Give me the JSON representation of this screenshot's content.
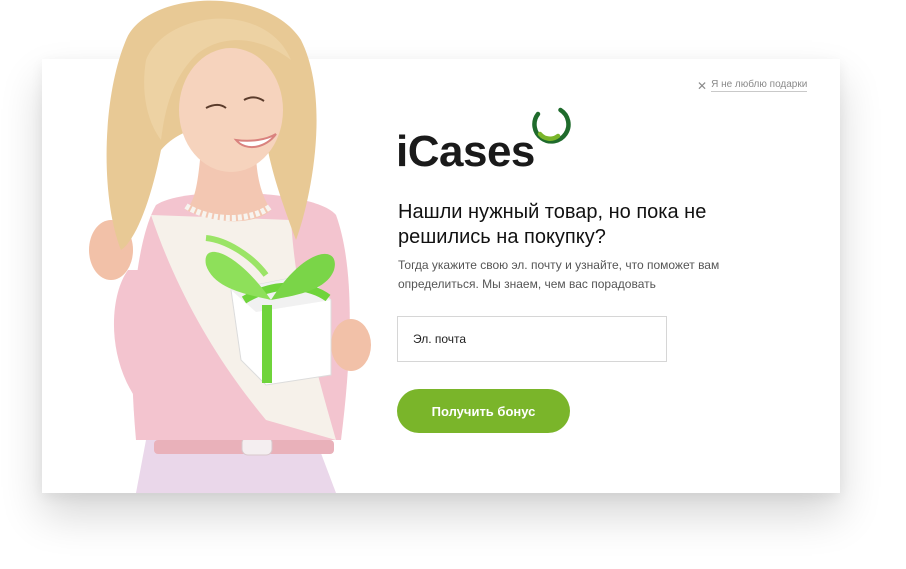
{
  "brand": {
    "name": "iCases",
    "accent": "#7ab52a",
    "ring_dark": "#1f6b2c"
  },
  "dismiss": {
    "icon": "close-icon",
    "label": "Я не люблю подарки"
  },
  "popup": {
    "headline": "Нашли нужный товар, но пока не решились на покупку?",
    "description": "Тогда укажите свою эл. почту и узнайте, что поможет вам определиться. Мы знаем, чем вас порадовать",
    "email_placeholder": "Эл. почта",
    "cta_label": "Получить бонус"
  }
}
